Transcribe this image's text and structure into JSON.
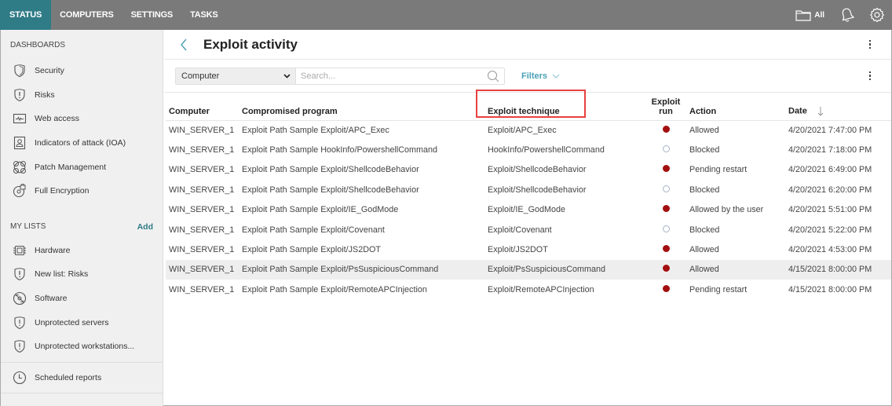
{
  "topnav": {
    "items": [
      {
        "label": "STATUS",
        "active": true
      },
      {
        "label": "COMPUTERS",
        "active": false
      },
      {
        "label": "SETTINGS",
        "active": false
      },
      {
        "label": "TASKS",
        "active": false
      }
    ],
    "folder_label": "All",
    "icons": [
      "folder-icon",
      "bell-icon",
      "gear-icon"
    ],
    "colors": {
      "bar": "#7a7a7a",
      "active_tab": "#2f7b86"
    }
  },
  "sidebar": {
    "dashboards_heading": "DASHBOARDS",
    "dashboards": [
      {
        "label": "Security",
        "icon": "shield-icon"
      },
      {
        "label": "Risks",
        "icon": "shield-alert-icon"
      },
      {
        "label": "Web access",
        "icon": "web-activity-icon"
      },
      {
        "label": "Indicators of attack (IOA)",
        "icon": "user-badge-icon"
      },
      {
        "label": "Patch Management",
        "icon": "patch-icon"
      },
      {
        "label": "Full Encryption",
        "icon": "encryption-disk-icon"
      }
    ],
    "lists_heading": "MY LISTS",
    "add_label": "Add",
    "lists": [
      {
        "label": "Hardware",
        "icon": "chip-icon"
      },
      {
        "label": "New list: Risks",
        "icon": "shield-alert-icon"
      },
      {
        "label": "Software",
        "icon": "software-disc-icon"
      },
      {
        "label": "Unprotected servers",
        "icon": "shield-alert-icon"
      },
      {
        "label": "Unprotected workstations...",
        "icon": "shield-alert-icon"
      }
    ],
    "scheduled_label": "Scheduled reports"
  },
  "page": {
    "title": "Exploit activity",
    "select_value": "Computer",
    "search_placeholder": "Search...",
    "filters_label": "Filters"
  },
  "table": {
    "columns": {
      "computer": "Computer",
      "program": "Compromised program",
      "technique": "Exploit technique",
      "run_line1": "Exploit",
      "run_line2": "run",
      "action": "Action",
      "date": "Date"
    },
    "sort": {
      "column": "Date",
      "direction": "descending"
    },
    "highlighted_column": "Exploit technique",
    "rows": [
      {
        "computer": "WIN_SERVER_1",
        "program": "Exploit Path Sample Exploit/APC_Exec",
        "technique": "Exploit/APC_Exec",
        "run": true,
        "action": "Allowed",
        "date": "4/20/2021 7:47:00 PM"
      },
      {
        "computer": "WIN_SERVER_1",
        "program": "Exploit Path Sample HookInfo/PowershellCommand",
        "technique": "HookInfo/PowershellCommand",
        "run": false,
        "action": "Blocked",
        "date": "4/20/2021 7:18:00 PM"
      },
      {
        "computer": "WIN_SERVER_1",
        "program": "Exploit Path Sample Exploit/ShellcodeBehavior",
        "technique": "Exploit/ShellcodeBehavior",
        "run": true,
        "action": "Pending restart",
        "date": "4/20/2021 6:49:00 PM"
      },
      {
        "computer": "WIN_SERVER_1",
        "program": "Exploit Path Sample Exploit/ShellcodeBehavior",
        "technique": "Exploit/ShellcodeBehavior",
        "run": false,
        "action": "Blocked",
        "date": "4/20/2021 6:20:00 PM"
      },
      {
        "computer": "WIN_SERVER_1",
        "program": "Exploit Path Sample Exploit/IE_GodMode",
        "technique": "Exploit/IE_GodMode",
        "run": true,
        "action": "Allowed by the user",
        "date": "4/20/2021 5:51:00 PM"
      },
      {
        "computer": "WIN_SERVER_1",
        "program": "Exploit Path Sample Exploit/Covenant",
        "technique": "Exploit/Covenant",
        "run": false,
        "action": "Blocked",
        "date": "4/20/2021 5:22:00 PM"
      },
      {
        "computer": "WIN_SERVER_1",
        "program": "Exploit Path Sample Exploit/JS2DOT",
        "technique": "Exploit/JS2DOT",
        "run": true,
        "action": "Allowed",
        "date": "4/20/2021 4:53:00 PM"
      },
      {
        "computer": "WIN_SERVER_1",
        "program": "Exploit Path Sample Exploit/PsSuspiciousCommand",
        "technique": "Exploit/PsSuspiciousCommand",
        "run": true,
        "action": "Allowed",
        "date": "4/15/2021 8:00:00 PM",
        "hovered": true
      },
      {
        "computer": "WIN_SERVER_1",
        "program": "Exploit Path Sample Exploit/RemoteAPCInjection",
        "technique": "Exploit/RemoteAPCInjection",
        "run": true,
        "action": "Pending restart",
        "date": "4/15/2021 8:00:00 PM"
      }
    ],
    "colors": {
      "run_yes": "#a30f0f",
      "run_no_border": "#a7b4c8",
      "highlight": "#e8413f"
    }
  }
}
